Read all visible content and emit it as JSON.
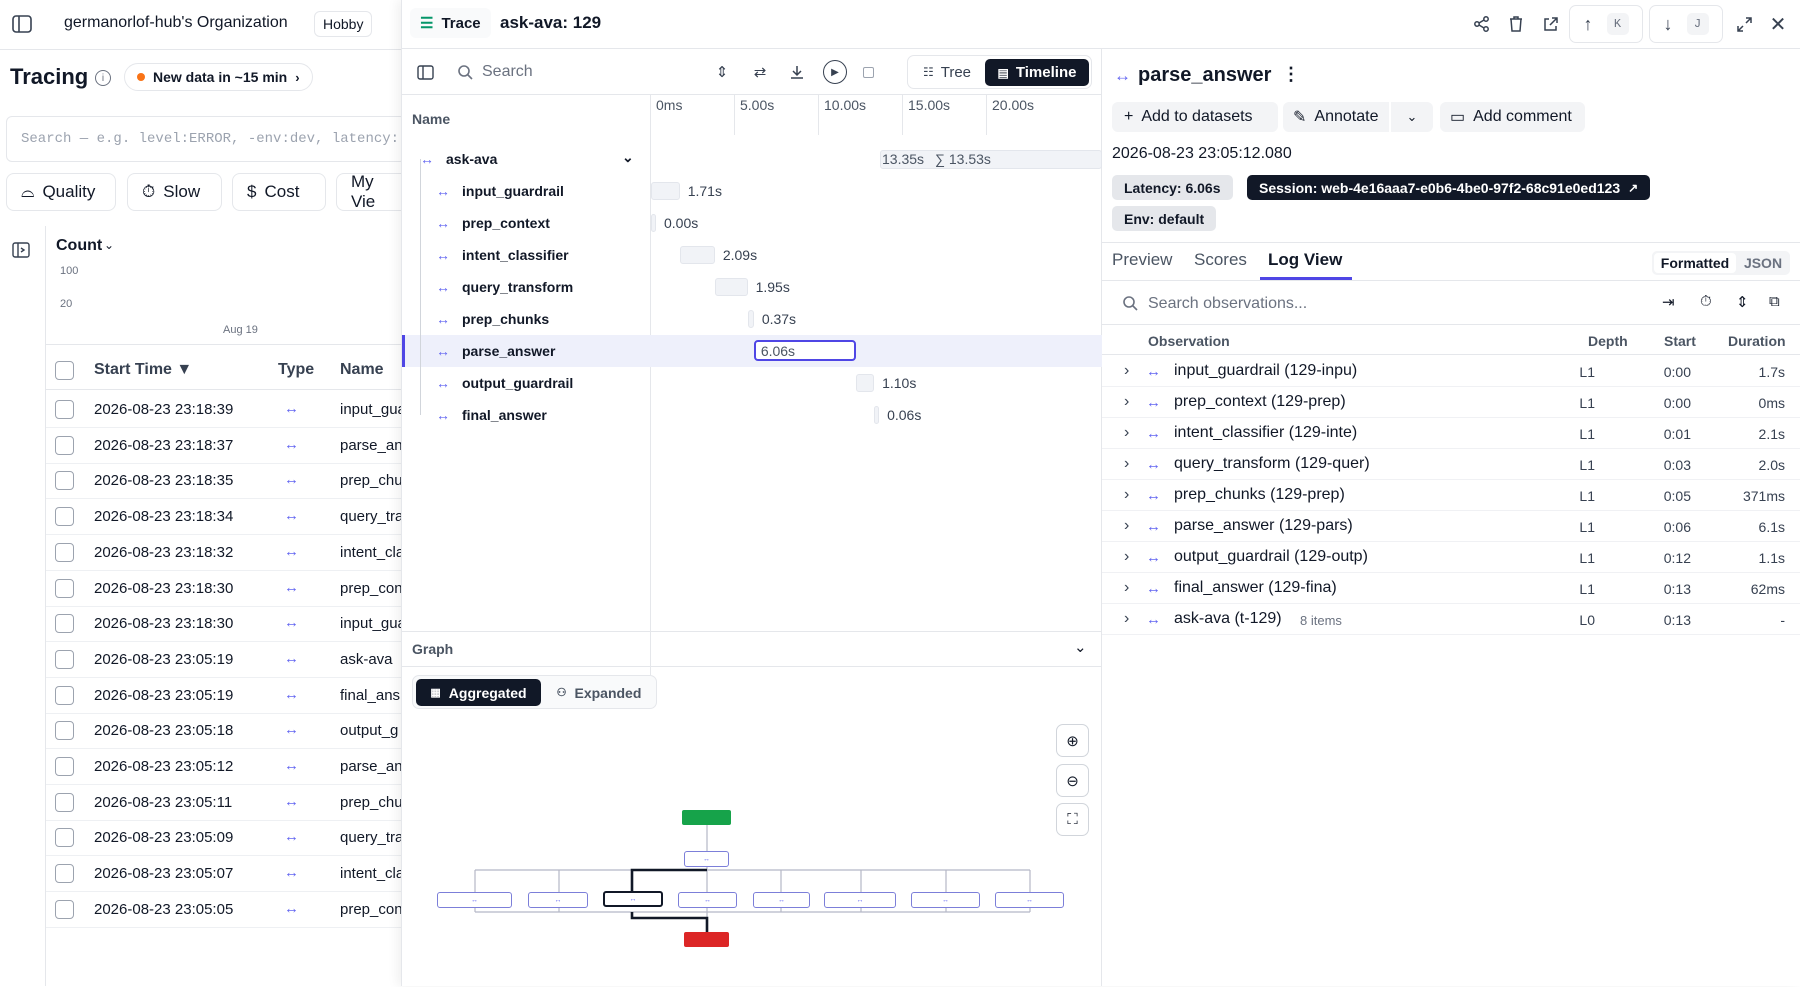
{
  "app": {
    "org_name": "germanorlof-hub's Organization",
    "plan": "Hobby",
    "page_title": "Tracing",
    "new_data": "New data in ~15 min",
    "search_placeholder": "Search — e.g. level:ERROR, -env:dev, latency:",
    "filters": [
      "Quality",
      "Slow",
      "Cost",
      "My Vie"
    ],
    "count_label": "Count",
    "y_ticks": [
      "100",
      "20"
    ],
    "x_tick": "Aug 19",
    "columns": {
      "start_time": "Start Time ▼",
      "type": "Type",
      "name": "Name"
    },
    "rows": [
      {
        "time": "2026-08-23 23:18:39",
        "name": "input_guar"
      },
      {
        "time": "2026-08-23 23:18:37",
        "name": "parse_an"
      },
      {
        "time": "2026-08-23 23:18:35",
        "name": "prep_chu"
      },
      {
        "time": "2026-08-23 23:18:34",
        "name": "query_tra"
      },
      {
        "time": "2026-08-23 23:18:32",
        "name": "intent_cla"
      },
      {
        "time": "2026-08-23 23:18:30",
        "name": "prep_con"
      },
      {
        "time": "2026-08-23 23:18:30",
        "name": "input_gua"
      },
      {
        "time": "2026-08-23 23:05:19",
        "name": "ask-ava"
      },
      {
        "time": "2026-08-23 23:05:19",
        "name": "final_ans"
      },
      {
        "time": "2026-08-23 23:05:18",
        "name": "output_g"
      },
      {
        "time": "2026-08-23 23:05:12",
        "name": "parse_an"
      },
      {
        "time": "2026-08-23 23:05:11",
        "name": "prep_chu"
      },
      {
        "time": "2026-08-23 23:05:09",
        "name": "query_tra"
      },
      {
        "time": "2026-08-23 23:05:07",
        "name": "intent_cla"
      },
      {
        "time": "2026-08-23 23:05:05",
        "name": "prep_con"
      }
    ]
  },
  "trace": {
    "badge": "Trace",
    "title": "ask-ava: 129",
    "kbd_up": "K",
    "kbd_down": "J",
    "search_placeholder": "Search",
    "view_tree": "Tree",
    "view_timeline": "Timeline",
    "name_header": "Name",
    "axis": [
      "0ms",
      "5.00s",
      "10.00s",
      "15.00s",
      "20.00s"
    ],
    "root": {
      "name": "ask-ava",
      "duration": "13.35s",
      "sum": "∑ 13.53s"
    },
    "spans": [
      {
        "name": "input_guardrail",
        "duration": "1.71s",
        "start_s": 0.0,
        "dur_s": 1.71
      },
      {
        "name": "prep_context",
        "duration": "0.00s",
        "start_s": 0.0,
        "dur_s": 0.0
      },
      {
        "name": "intent_classifier",
        "duration": "2.09s",
        "start_s": 1.71,
        "dur_s": 2.09
      },
      {
        "name": "query_transform",
        "duration": "1.95s",
        "start_s": 3.8,
        "dur_s": 1.95
      },
      {
        "name": "prep_chunks",
        "duration": "0.37s",
        "start_s": 5.75,
        "dur_s": 0.37
      },
      {
        "name": "parse_answer",
        "duration": "6.06s",
        "start_s": 6.12,
        "dur_s": 6.06,
        "selected": true
      },
      {
        "name": "output_guardrail",
        "duration": "1.10s",
        "start_s": 12.18,
        "dur_s": 1.1
      },
      {
        "name": "final_answer",
        "duration": "0.06s",
        "start_s": 13.28,
        "dur_s": 0.06
      }
    ],
    "graph": {
      "title": "Graph",
      "aggregated": "Aggregated",
      "expanded": "Expanded",
      "node_glyph": "↔"
    }
  },
  "detail": {
    "title": "parse_answer",
    "add_to_datasets": "Add to datasets",
    "annotate": "Annotate",
    "add_comment": "Add comment",
    "timestamp": "2026-08-23 23:05:12.080",
    "latency": "Latency: 6.06s",
    "session": "Session: web-4e16aaa7-e0b6-4be0-97f2-68c91e0ed123",
    "env": "Env: default",
    "tabs": [
      "Preview",
      "Scores",
      "Log View"
    ],
    "format_formatted": "Formatted",
    "format_json": "JSON",
    "search_placeholder": "Search observations...",
    "columns": {
      "observation": "Observation",
      "depth": "Depth",
      "start": "Start",
      "duration": "Duration"
    },
    "observations": [
      {
        "name": "input_guardrail (129-inpu)",
        "extra": "",
        "depth": "L1",
        "start": "0:00",
        "duration": "1.7s"
      },
      {
        "name": "prep_context (129-prep)",
        "extra": "",
        "depth": "L1",
        "start": "0:00",
        "duration": "0ms"
      },
      {
        "name": "intent_classifier (129-inte)",
        "extra": "",
        "depth": "L1",
        "start": "0:01",
        "duration": "2.1s"
      },
      {
        "name": "query_transform (129-quer)",
        "extra": "",
        "depth": "L1",
        "start": "0:03",
        "duration": "2.0s"
      },
      {
        "name": "prep_chunks (129-prep)",
        "extra": "",
        "depth": "L1",
        "start": "0:05",
        "duration": "371ms"
      },
      {
        "name": "parse_answer (129-pars)",
        "extra": "",
        "depth": "L1",
        "start": "0:06",
        "duration": "6.1s"
      },
      {
        "name": "output_guardrail (129-outp)",
        "extra": "",
        "depth": "L1",
        "start": "0:12",
        "duration": "1.1s"
      },
      {
        "name": "final_answer (129-fina)",
        "extra": "",
        "depth": "L1",
        "start": "0:13",
        "duration": "62ms"
      },
      {
        "name": "ask-ava (t-129)",
        "extra": "8 items",
        "depth": "L0",
        "start": "0:13",
        "duration": "-"
      }
    ]
  },
  "colors": {
    "accent": "#4f46e5",
    "arrow": "#6366f1",
    "dark": "#111827",
    "green": "#16a34a",
    "red": "#dc2626",
    "orange": "#f97316"
  }
}
